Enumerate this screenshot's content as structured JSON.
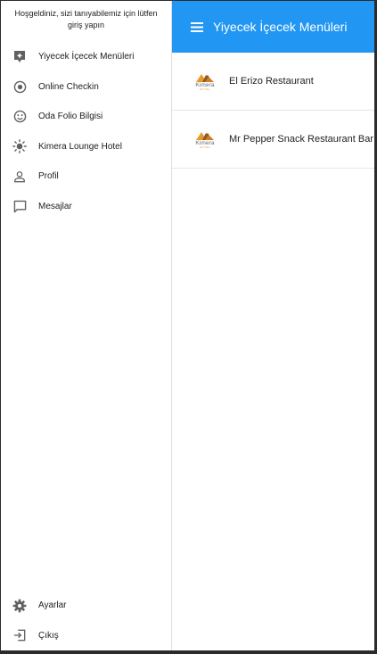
{
  "appbar": {
    "title": "Yiyecek İçecek Menüleri",
    "menu_icon": "menu-icon",
    "background": "#2196f3"
  },
  "drawer": {
    "welcome_text": "Hoşgeldiniz, sizi tanıyabilemiz için lütfen giriş yapın",
    "items": [
      {
        "label": "Yiyecek İçecek Menüleri",
        "icon": "food-menu-icon"
      },
      {
        "label": "Online Checkin",
        "icon": "radio-target-icon"
      },
      {
        "label": "Oda Folio Bilgisi",
        "icon": "smiley-icon"
      },
      {
        "label": "Kimera Lounge Hotel",
        "icon": "sun-icon"
      },
      {
        "label": "Profil",
        "icon": "person-icon"
      },
      {
        "label": "Mesajlar",
        "icon": "message-icon"
      }
    ],
    "bottom_items": [
      {
        "label": "Ayarlar",
        "icon": "gear-icon"
      },
      {
        "label": "Çıkış",
        "icon": "logout-icon"
      }
    ]
  },
  "restaurants": [
    {
      "name": "El Erizo Restaurant",
      "logo_text": "Kimera",
      "logo_sub": "HOTEL"
    },
    {
      "name": "Mr Pepper Snack Restaurant Bar",
      "logo_text": "Kimera",
      "logo_sub": "HOTEL"
    }
  ],
  "colors": {
    "accent": "#2196f3",
    "icon_gray": "#616161",
    "logo_orange": "#e69a2e",
    "logo_brown": "#8a5a2b"
  }
}
